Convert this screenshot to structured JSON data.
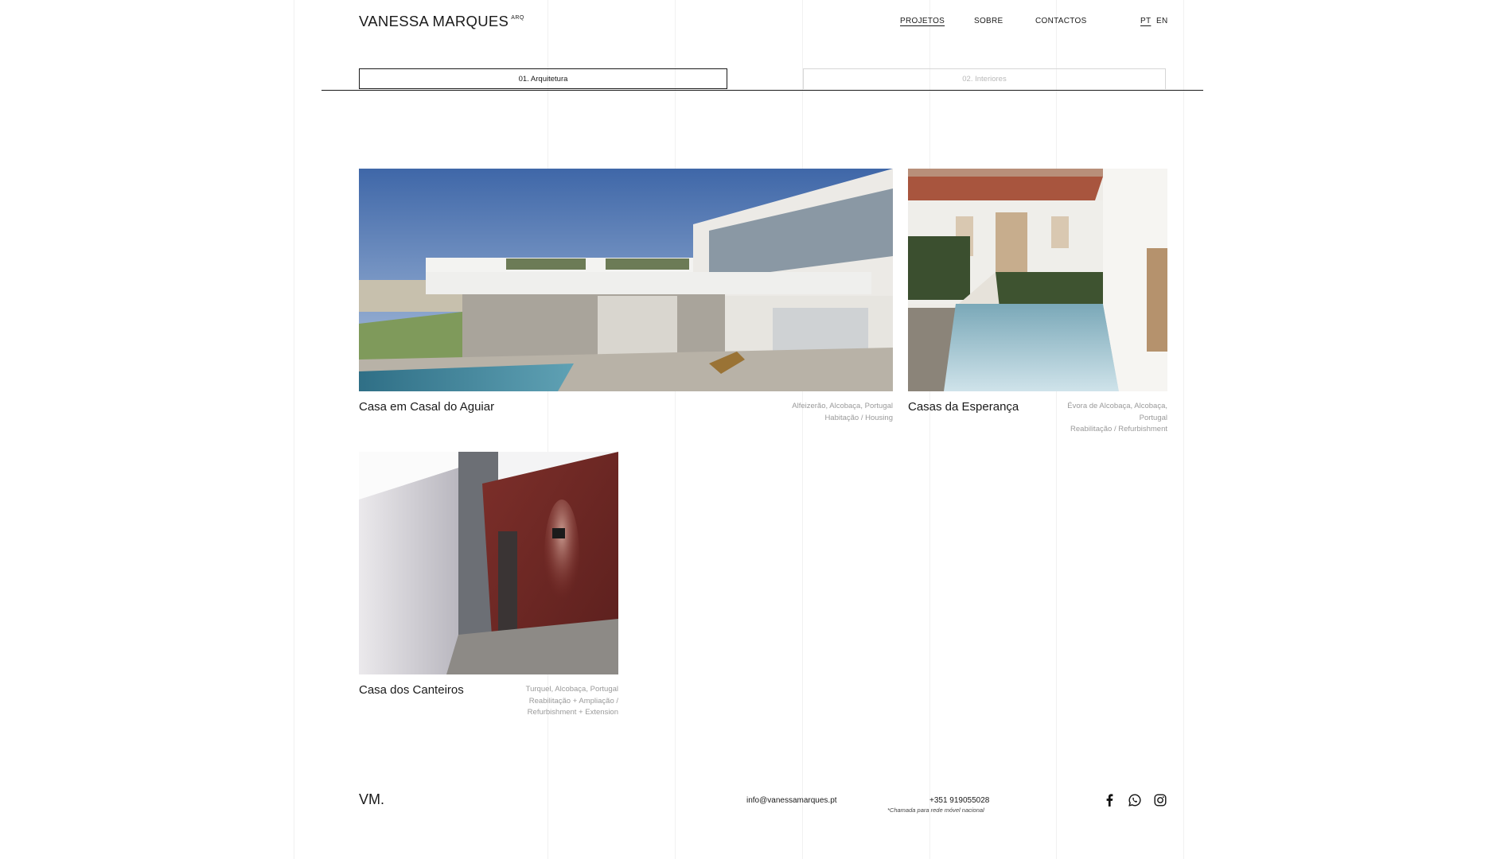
{
  "header": {
    "brand": "VANESSA MARQUES",
    "brand_suffix": "ARQ",
    "nav": [
      "PROJETOS",
      "SOBRE",
      "CONTACTOS"
    ],
    "languages": [
      "PT",
      "EN"
    ],
    "active_language": "PT"
  },
  "tabs": [
    {
      "label": "01. Arquitetura",
      "active": true
    },
    {
      "label": "02. Interiores",
      "active": false
    }
  ],
  "projects": [
    {
      "title": "Casa em Casal do Aguiar",
      "meta": [
        "Alfeizerão, Alcobaça, Portugal",
        "Habitação / Housing"
      ]
    },
    {
      "title": "Casas da Esperança",
      "meta": [
        "Évora de Alcobaça, Alcobaça,",
        "Portugal",
        "Reabilitação / Refurbishment"
      ]
    },
    {
      "title": "Casa dos Canteiros",
      "meta": [
        "Turquel, Alcobaça, Portugal",
        "Reabilitação + Ampliação /",
        "Refurbishment + Extension"
      ]
    }
  ],
  "footer": {
    "logo": "VM.",
    "email": "info@vanessamarques.pt",
    "phone": "+351 919055028",
    "phone_note": "*Chamada para rede móvel nacional",
    "social_icons": [
      "facebook-icon",
      "whatsapp-icon",
      "instagram-icon"
    ]
  }
}
